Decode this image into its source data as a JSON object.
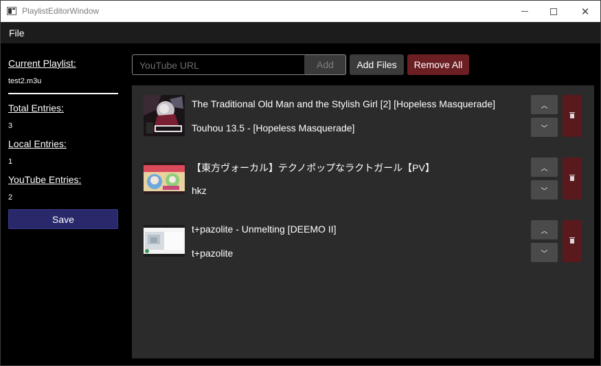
{
  "window": {
    "title": "PlaylistEditorWindow"
  },
  "menu": {
    "file": "File"
  },
  "sidebar": {
    "current_playlist_label": "Current Playlist:",
    "current_playlist_value": "test2.m3u",
    "total_entries_label": "Total Entries:",
    "total_entries_value": "3",
    "local_entries_label": "Local Entries:",
    "local_entries_value": "1",
    "youtube_entries_label": "YouTube Entries:",
    "youtube_entries_value": "2",
    "save_label": "Save"
  },
  "toolbar": {
    "url_placeholder": "YouTube URL",
    "add_label": "Add",
    "add_files_label": "Add Files",
    "remove_all_label": "Remove All"
  },
  "entries": [
    {
      "title": "The Traditional Old Man and the Stylish Girl [2] [Hopeless Masquerade]",
      "subtitle": "Touhou 13.5 - [Hopeless Masquerade]"
    },
    {
      "title": "【東方ヴォーカル】テクノポップなラクトガール【PV】",
      "subtitle": "hkz"
    },
    {
      "title": "t+pazolite - Unmelting [DEEMO II]",
      "subtitle": "t+pazolite"
    }
  ],
  "icons": {
    "up": "chevron-up-icon",
    "down": "chevron-down-icon",
    "delete": "trash-icon"
  },
  "colors": {
    "save_button": "#28286a",
    "remove_all_button": "#6b1f23",
    "delete_button": "#5a1a1d",
    "panel": "#2b2b2b"
  }
}
